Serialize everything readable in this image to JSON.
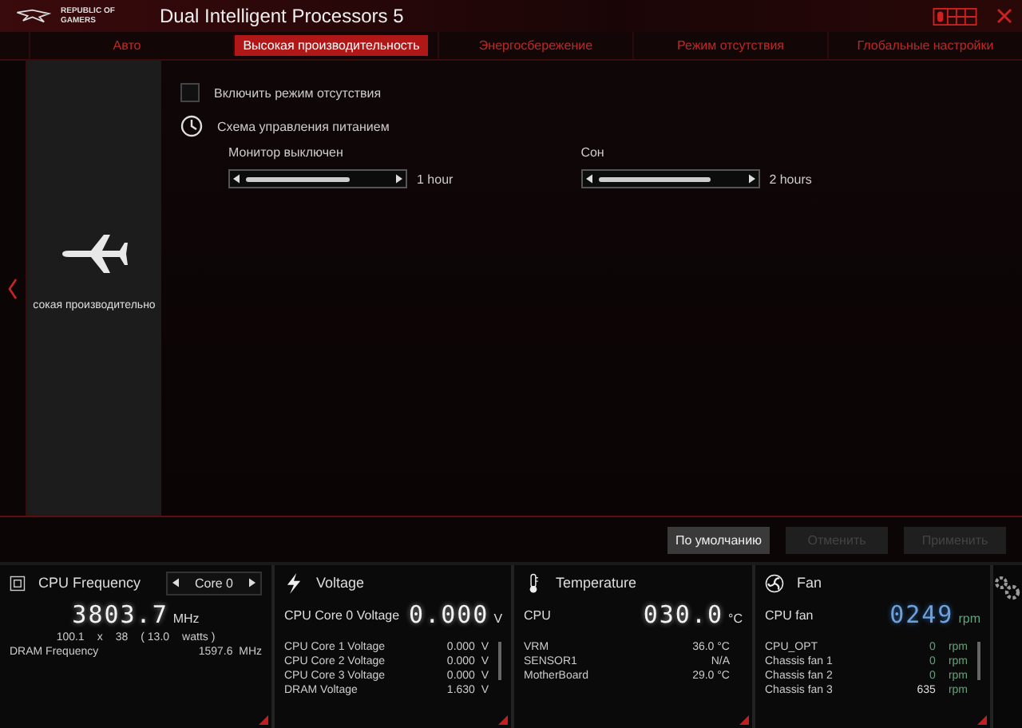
{
  "window": {
    "logo_text": "REPUBLIC OF GAMERS",
    "title": "Dual Intelligent Processors 5"
  },
  "tabs": [
    {
      "label": "Авто",
      "selected": false
    },
    {
      "label": "Высокая производительность",
      "selected": true
    },
    {
      "label": "Энергосбережение",
      "selected": false
    },
    {
      "label": "Режим отсутствия",
      "selected": false
    },
    {
      "label": "Глобальные настройки",
      "selected": false
    }
  ],
  "mode_panel": {
    "label": "сокая производительно"
  },
  "away_mode": {
    "label": "Включить режим отсутствия",
    "checked": false
  },
  "power_scheme": {
    "title": "Схема управления питанием",
    "sliders": [
      {
        "label": "Монитор выключен",
        "level": 0.72,
        "reading": "1 hour"
      },
      {
        "label": "Сон",
        "level": 0.78,
        "reading": "2 hours"
      }
    ]
  },
  "buttons": [
    {
      "label": "По умолчанию",
      "disabled": false
    },
    {
      "label": "Отменить",
      "disabled": true
    },
    {
      "label": "Применить",
      "disabled": true
    }
  ],
  "cpu_frequency": {
    "title": "CPU Frequency",
    "core": "Core 0",
    "value": "3803.7",
    "unit": "MHz",
    "bclk": "100.1",
    "x": "x",
    "ratio": "38",
    "watts_open": "( 13.0",
    "watts_unit": "watts )",
    "dram_label": "DRAM Frequency",
    "dram_value": "1597.6  MHz"
  },
  "voltage": {
    "title": "Voltage",
    "main_label": "CPU Core 0 Voltage",
    "main_value": "0.000",
    "main_unit": "V",
    "rows": [
      {
        "label": "CPU Core 1 Voltage",
        "value": "0.000  V"
      },
      {
        "label": "CPU Core 2 Voltage",
        "value": "0.000  V"
      },
      {
        "label": "CPU Core 3 Voltage",
        "value": "0.000  V"
      },
      {
        "label": "DRAM Voltage",
        "value": "1.630  V"
      }
    ]
  },
  "temperature": {
    "title": "Temperature",
    "main_label": "CPU",
    "main_value": "030.0",
    "main_unit": "°C",
    "rows": [
      {
        "label": "VRM",
        "value": "36.0 °C"
      },
      {
        "label": "SENSOR1",
        "value": "N/A"
      },
      {
        "label": "MotherBoard",
        "value": "29.0 °C"
      }
    ]
  },
  "fan": {
    "title": "Fan",
    "main_label": "CPU fan",
    "main_value": "0249",
    "main_unit": "rpm",
    "rows": [
      {
        "label": "CPU_OPT",
        "value": "0",
        "unit": "rpm",
        "color": "#5fa37a"
      },
      {
        "label": "Chassis fan 1",
        "value": "0",
        "unit": "rpm",
        "color": "#5fa37a"
      },
      {
        "label": "Chassis fan 2",
        "value": "0",
        "unit": "rpm",
        "color": "#5fa37a"
      },
      {
        "label": "Chassis fan 3",
        "value": "635",
        "unit": "rpm",
        "color": "#dddddd"
      }
    ]
  }
}
